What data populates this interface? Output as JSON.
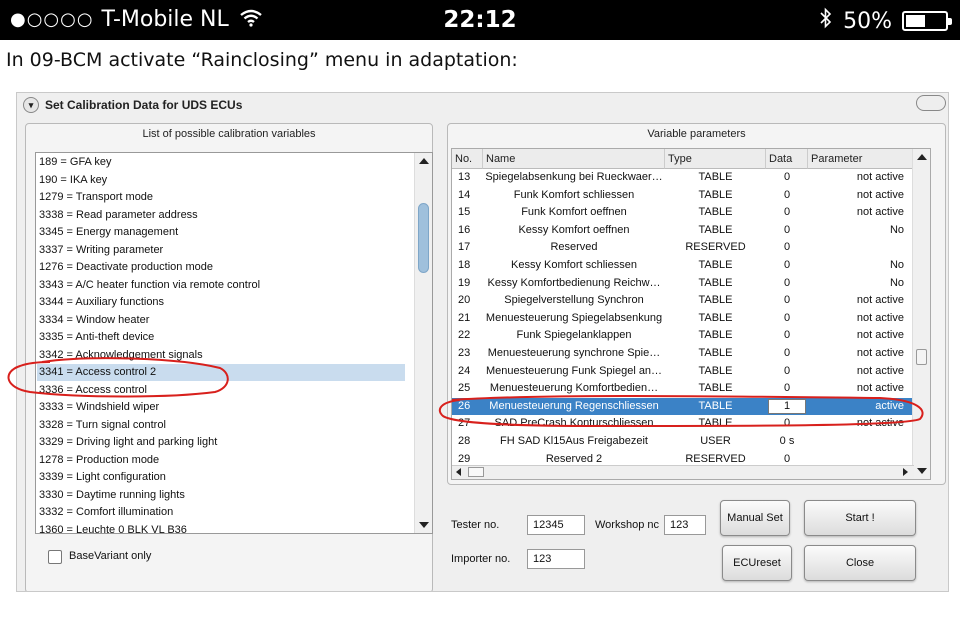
{
  "status_bar": {
    "signal": "●○○○○",
    "carrier": "T-Mobile NL",
    "wifi_icon": "wifi-icon",
    "time": "22:12",
    "bluetooth_icon": "bluetooth-icon",
    "battery_percent": "50%",
    "battery_level": 0.5
  },
  "caption": "In 09-BCM activate “Rainclosing” menu in adaptation:",
  "window": {
    "title": "Set Calibration Data for UDS ECUs",
    "left_panel": {
      "title": "List of possible calibration variables",
      "items": [
        "189 = GFA key",
        "190 = IKA key",
        "1279 = Transport mode",
        "3338 = Read parameter address",
        "3345 = Energy management",
        "3337 = Writing parameter",
        "1276 = Deactivate production mode",
        "3343 = A/C heater function via remote control",
        "3344 = Auxiliary functions",
        "3334 = Window heater",
        "3335 = Anti-theft device",
        "3342 = Acknowledgement signals",
        "3341 = Access control 2",
        "3336 = Access control",
        "3333 = Windshield wiper",
        "3328 = Turn signal control",
        "3329 = Driving light and parking light",
        "1278 = Production mode",
        "3339 = Light configuration",
        "3330 = Daytime running lights",
        "3332 = Comfort illumination",
        "1360 = Leuchte 0 BLK VL B36"
      ],
      "selected_index": 12,
      "base_variant_label": "BaseVariant only"
    },
    "right_panel": {
      "title": "Variable parameters",
      "columns": [
        "No.",
        "Name",
        "Type",
        "Data",
        "Parameter"
      ],
      "rows": [
        [
          "13",
          "Spiegelabsenkung bei Rueckwaer…",
          "TABLE",
          "0",
          "not active"
        ],
        [
          "14",
          "Funk Komfort schliessen",
          "TABLE",
          "0",
          "not active"
        ],
        [
          "15",
          "Funk Komfort oeffnen",
          "TABLE",
          "0",
          "not active"
        ],
        [
          "16",
          "Kessy Komfort oeffnen",
          "TABLE",
          "0",
          "No"
        ],
        [
          "17",
          "Reserved",
          "RESERVED",
          "0",
          ""
        ],
        [
          "18",
          "Kessy Komfort schliessen",
          "TABLE",
          "0",
          "No"
        ],
        [
          "19",
          "Kessy Komfortbedienung Reichw…",
          "TABLE",
          "0",
          "No"
        ],
        [
          "20",
          "Spiegelverstellung Synchron",
          "TABLE",
          "0",
          "not active"
        ],
        [
          "21",
          "Menuesteuerung Spiegelabsenkung",
          "TABLE",
          "0",
          "not active"
        ],
        [
          "22",
          "Funk Spiegelanklappen",
          "TABLE",
          "0",
          "not active"
        ],
        [
          "23",
          "Menuesteuerung synchrone Spie…",
          "TABLE",
          "0",
          "not active"
        ],
        [
          "24",
          "Menuesteuerung Funk Spiegel an…",
          "TABLE",
          "0",
          "not active"
        ],
        [
          "25",
          "Menuesteuerung Komfortbedien…",
          "TABLE",
          "0",
          "not active"
        ],
        [
          "26",
          "Menuesteuerung Regenschliessen",
          "TABLE",
          "1",
          "active"
        ],
        [
          "27",
          "SAD PreCrash Konturschliessen",
          "TABLE",
          "0",
          "not active"
        ],
        [
          "28",
          "FH SAD Kl15Aus Freigabezeit",
          "USER",
          "0 s",
          ""
        ],
        [
          "29",
          "Reserved 2",
          "RESERVED",
          "0",
          ""
        ]
      ],
      "selected_index": 13
    },
    "tester_label": "Tester no.",
    "tester_value": "12345",
    "workshop_label": "Workshop nc",
    "workshop_value": "123",
    "importer_label": "Importer no.",
    "importer_value": "123",
    "buttons": {
      "manual_set": "Manual Set",
      "start": "Start !",
      "ecu_reset": "ECUreset",
      "close": "Close"
    },
    "annotation_color": "#d8201c",
    "selection_color": "#3b82c6"
  }
}
